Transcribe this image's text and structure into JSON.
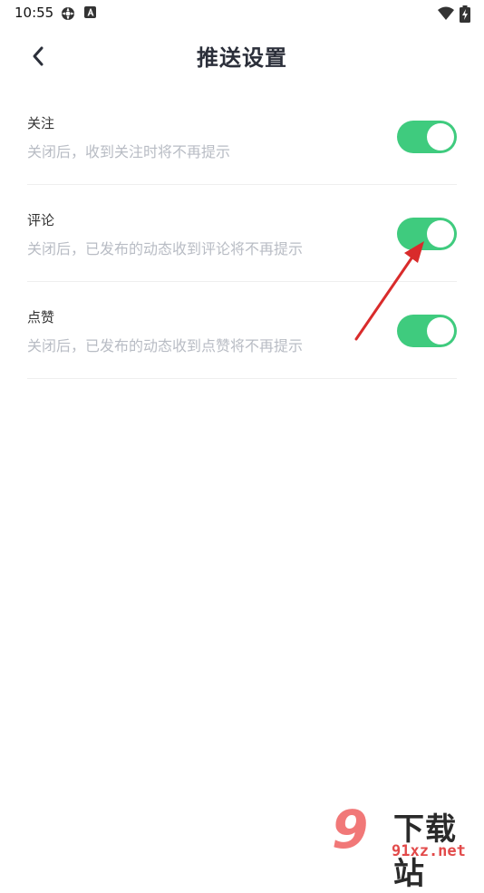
{
  "status_bar": {
    "time": "10:55",
    "icons": [
      "gear-icon",
      "a-badge-icon",
      "wifi-icon",
      "battery-charging-icon"
    ]
  },
  "header": {
    "back_icon": "chevron-left-icon",
    "title": "推送设置"
  },
  "settings": [
    {
      "title": "关注",
      "description": "关闭后，收到关注时将不再提示",
      "enabled": true
    },
    {
      "title": "评论",
      "description": "关闭后，已发布的动态收到评论将不再提示",
      "enabled": true
    },
    {
      "title": "点赞",
      "description": "关闭后，已发布的动态收到点赞将不再提示",
      "enabled": true
    }
  ],
  "colors": {
    "toggle_on": "#3fcb7e",
    "title": "#2b2f3a",
    "description": "#b8bcc4",
    "annotation_arrow": "#d92b2b"
  },
  "watermark": {
    "title": "下载站",
    "url": "91xz.net"
  }
}
